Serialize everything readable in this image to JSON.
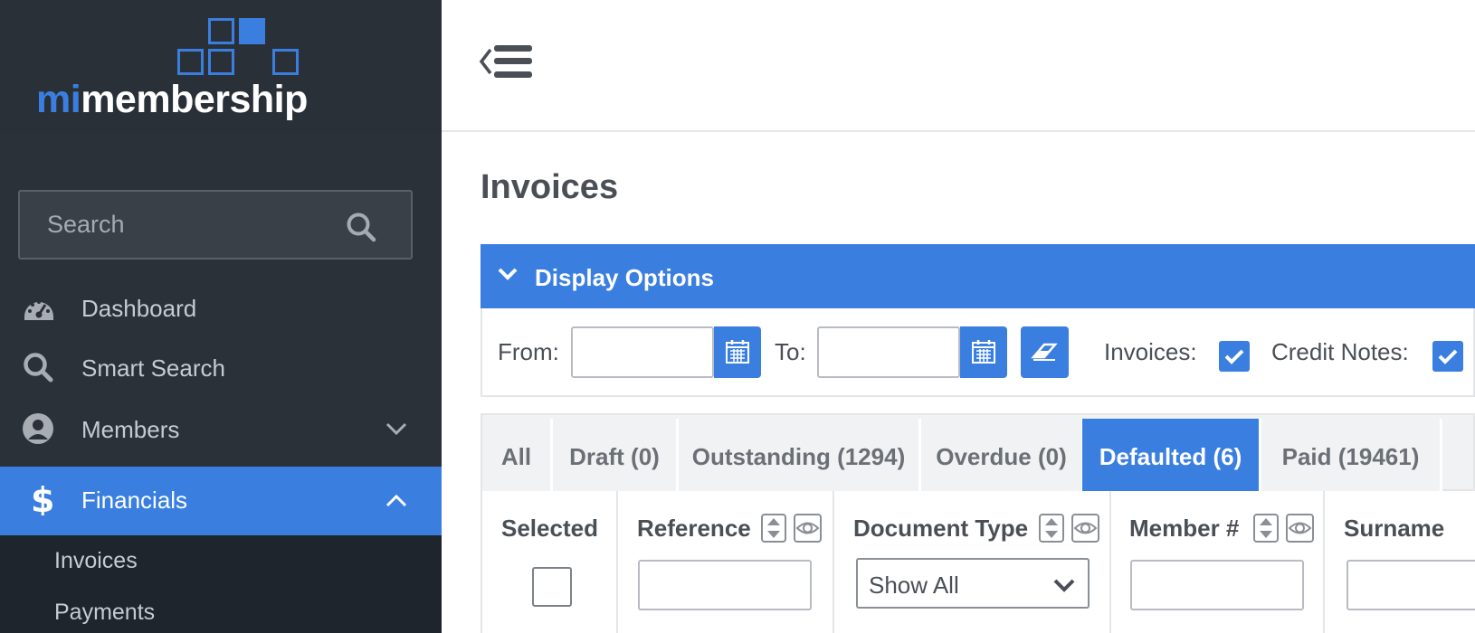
{
  "brand": {
    "logo_prefix": "mi",
    "logo_suffix": "membership"
  },
  "sidebar": {
    "search_placeholder": "Search",
    "items": [
      {
        "label": "Dashboard",
        "icon": "dashboard-icon"
      },
      {
        "label": "Smart Search",
        "icon": "search-icon"
      },
      {
        "label": "Members",
        "icon": "user-circle-icon",
        "expandable": true
      },
      {
        "label": "Financials",
        "icon": "dollar-icon",
        "active": true,
        "expanded": true
      }
    ],
    "subitems": [
      {
        "label": "Invoices"
      },
      {
        "label": "Payments"
      }
    ]
  },
  "page": {
    "title": "Invoices"
  },
  "display_options": {
    "label": "Display Options",
    "from_label": "From:",
    "to_label": "To:",
    "from_value": "",
    "to_value": "",
    "invoices_label": "Invoices:",
    "invoices_checked": true,
    "credit_notes_label": "Credit Notes:",
    "credit_notes_checked": true
  },
  "tabs": [
    {
      "label": "All"
    },
    {
      "label": "Draft (0)"
    },
    {
      "label": "Outstanding (1294)"
    },
    {
      "label": "Overdue (0)"
    },
    {
      "label": "Defaulted (6)",
      "active": true
    },
    {
      "label": "Paid (19461)"
    }
  ],
  "columns": {
    "selected": "Selected",
    "reference": "Reference",
    "document_type": "Document Type",
    "document_type_value": "Show All",
    "member_no": "Member #",
    "surname": "Surname"
  },
  "colors": {
    "accent": "#3a7fe0",
    "sidebar": "#2b3139",
    "sidebar_sub": "#1f252c"
  }
}
